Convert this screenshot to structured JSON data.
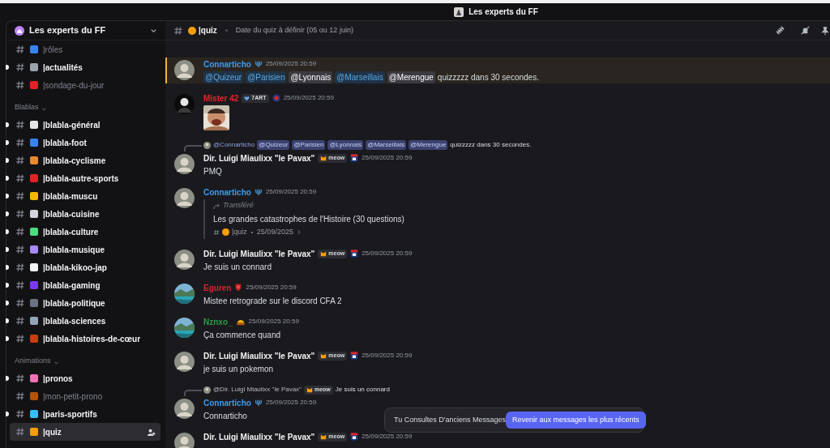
{
  "title_bar": {
    "title": "Les experts du FF"
  },
  "sidebar": {
    "server_name": "Les experts du FF",
    "groups": [
      {
        "channels": [
          {
            "name": "|rôles",
            "color": "#3b82f6",
            "unread": false,
            "selected": false
          },
          {
            "name": "|actualités",
            "color": "#9ca3af",
            "unread": true,
            "selected": false
          },
          {
            "name": "|sondage-du-jour",
            "color": "#dc2626",
            "unread": false,
            "selected": false
          }
        ]
      },
      {
        "category": "Blablas",
        "expanded": true,
        "channels": [
          {
            "name": "|blabla-général",
            "color": "#e5e7eb",
            "unread": true,
            "selected": false
          },
          {
            "name": "|blabla-foot",
            "color": "#3b82f6",
            "unread": true,
            "selected": false
          },
          {
            "name": "|blabla-cyclisme",
            "color": "#ea8a2e",
            "unread": true,
            "selected": false
          },
          {
            "name": "|blabla-autre-sports",
            "color": "#dc2626",
            "unread": true,
            "selected": false
          },
          {
            "name": "|blabla-muscu",
            "color": "#f5b800",
            "unread": true,
            "selected": false
          },
          {
            "name": "|blabla-cuisine",
            "color": "#d1d5db",
            "unread": true,
            "selected": false
          },
          {
            "name": "|blabla-culture",
            "color": "#4ade80",
            "unread": true,
            "selected": false
          },
          {
            "name": "|blabla-musique",
            "color": "#a78bfa",
            "unread": true,
            "selected": false
          },
          {
            "name": "|blabla-kikoo-jap",
            "color": "#f3f4f6",
            "unread": true,
            "selected": false
          },
          {
            "name": "|blabla-gaming",
            "color": "#7c3aed",
            "unread": true,
            "selected": false
          },
          {
            "name": "|blabla-politique",
            "color": "#6b7280",
            "unread": true,
            "selected": false
          },
          {
            "name": "|blabla-sciences",
            "color": "#94a3b8",
            "unread": true,
            "selected": false
          },
          {
            "name": "|blabla-histoires-de-cœur",
            "color": "#c2410c",
            "unread": true,
            "selected": false
          }
        ]
      },
      {
        "category": "Animations",
        "expanded": true,
        "channels": [
          {
            "name": "|pronos",
            "color": "#f472b6",
            "unread": true,
            "selected": false
          },
          {
            "name": "|mon-petit-prono",
            "color": "#b45309",
            "unread": false,
            "selected": false
          },
          {
            "name": "|paris-sportifs",
            "color": "#38bdf8",
            "unread": true,
            "selected": false
          },
          {
            "name": "|quiz",
            "color": "#f59e0b",
            "unread": false,
            "selected": true
          }
        ]
      }
    ]
  },
  "header": {
    "channel": "|quiz",
    "topic": "Date du quiz à définir (05 ou 12 juin)"
  },
  "messages": [
    {
      "author": {
        "name": "Connarticho",
        "color": "#3b9cf5"
      },
      "avatar": {
        "kind": "person"
      },
      "role_icon": {
        "kind": "trident"
      },
      "timestamp": "25/09/2025 20:59",
      "highlighted": true,
      "content": [
        {
          "kind": "role-mention",
          "text": "@Quizeur"
        },
        {
          "kind": "role-mention",
          "text": "@Parisien"
        },
        {
          "kind": "user-mention",
          "text": "@Lyonnais"
        },
        {
          "kind": "role-mention",
          "text": "@Marseillais"
        },
        {
          "kind": "user-mention",
          "text": "@Merengue"
        },
        {
          "kind": "text",
          "text": "quizzzzz dans 30 secondes."
        }
      ]
    },
    {
      "author": {
        "name": "Mister 42",
        "color": "#e5262b"
      },
      "avatar": {
        "kind": "dark"
      },
      "tag": {
        "text": "7ART",
        "icon": {
          "kind": "heart"
        }
      },
      "role_icon": {
        "kind": "crest-round"
      },
      "timestamp": "25/09/2025 20:59",
      "highlighted": false
    },
    {
      "reply": {
        "author": "@Connarticho",
        "content": [
          {
            "kind": "role-mention",
            "text": "@Quizeur"
          },
          {
            "kind": "role-mention",
            "text": "@Parisien"
          },
          {
            "kind": "role-mention",
            "text": "@Lyonnais"
          },
          {
            "kind": "role-mention",
            "text": "@Marseillais"
          },
          {
            "kind": "role-mention",
            "text": "@Merengue"
          },
          {
            "kind": "text",
            "text": "quizzzzz dans 30 secondes."
          }
        ]
      },
      "author": {
        "name": "Dir. Luigi Miaulixx \"le Pavax\"",
        "color": "#f2f3f5"
      },
      "avatar": {
        "kind": "person"
      },
      "tag": {
        "text": "meow",
        "icon": {
          "kind": "cat"
        }
      },
      "role_icon": {
        "kind": "crest-square"
      },
      "timestamp": "25/09/2025 20:59",
      "highlighted": false,
      "content": [
        {
          "kind": "text",
          "text": "PMQ"
        }
      ]
    },
    {
      "author": {
        "name": "Connarticho",
        "color": "#3b9cf5"
      },
      "avatar": {
        "kind": "person"
      },
      "role_icon": {
        "kind": "trident"
      },
      "timestamp": "25/09/2025 20:59",
      "highlighted": false,
      "forward": {
        "label": "Transféré",
        "text": "Les grandes catastrophes de l'Histoire (30 questions)",
        "channel": "|quiz",
        "date": "25/09/2025"
      }
    },
    {
      "author": {
        "name": "Dir. Luigi Miaulixx \"le Pavax\"",
        "color": "#f2f3f5"
      },
      "avatar": {
        "kind": "person"
      },
      "tag": {
        "text": "meow",
        "icon": {
          "kind": "cat"
        }
      },
      "role_icon": {
        "kind": "crest-square"
      },
      "timestamp": "25/09/2025 20:59",
      "highlighted": false,
      "content": [
        {
          "kind": "text",
          "text": "Je suis un connard"
        }
      ]
    },
    {
      "author": {
        "name": "Eguren",
        "color": "#d3272b"
      },
      "avatar": {
        "kind": "landscape"
      },
      "role_icon": {
        "kind": "shield"
      },
      "timestamp": "25/09/2025 20:59",
      "highlighted": false,
      "content": [
        {
          "kind": "text",
          "text": "Mistee retrograde sur le discord CFA 2"
        }
      ]
    },
    {
      "author": {
        "name": "Nznxo_",
        "color": "#2e9a48"
      },
      "avatar": {
        "kind": "landscape"
      },
      "role_icon": {
        "kind": "helmet"
      },
      "timestamp": "25/09/2025 20:59",
      "highlighted": false,
      "content": [
        {
          "kind": "text",
          "text": "Ça commence quand"
        }
      ]
    },
    {
      "author": {
        "name": "Dir. Luigi Miaulixx \"le Pavax\"",
        "color": "#f2f3f5"
      },
      "avatar": {
        "kind": "person"
      },
      "tag": {
        "text": "meow",
        "icon": {
          "kind": "cat"
        }
      },
      "role_icon": {
        "kind": "crest-square"
      },
      "timestamp": "25/09/2025 20:59",
      "highlighted": false,
      "content": [
        {
          "kind": "text",
          "text": "je suis un pokemon"
        }
      ]
    },
    {
      "reply": {
        "author": "@Dir. Luigi Miaulixx \"le Pavax\"",
        "tag": {
          "text": "meow",
          "icon": {
            "kind": "cat"
          }
        },
        "content": [
          {
            "kind": "text",
            "text": "Je suis un connard"
          }
        ]
      },
      "author": {
        "name": "Connarticho",
        "color": "#3b9cf5"
      },
      "avatar": {
        "kind": "person"
      },
      "role_icon": {
        "kind": "trident"
      },
      "timestamp": "25/09/2025 20:59",
      "highlighted": false,
      "content": [
        {
          "kind": "text",
          "text": "Connarticho"
        }
      ]
    },
    {
      "author": {
        "name": "Dir. Luigi Miaulixx \"le Pavax\"",
        "color": "#f2f3f5"
      },
      "avatar": {
        "kind": "person"
      },
      "tag": {
        "text": "meow",
        "icon": {
          "kind": "cat"
        }
      },
      "role_icon": {
        "kind": "crest-square"
      },
      "timestamp": "25/09/2025 20:59",
      "highlighted": false
    }
  ],
  "toast": {
    "text": "Tu Consultes D'anciens Messages",
    "button": "Revenir aux messages les plus récents"
  }
}
